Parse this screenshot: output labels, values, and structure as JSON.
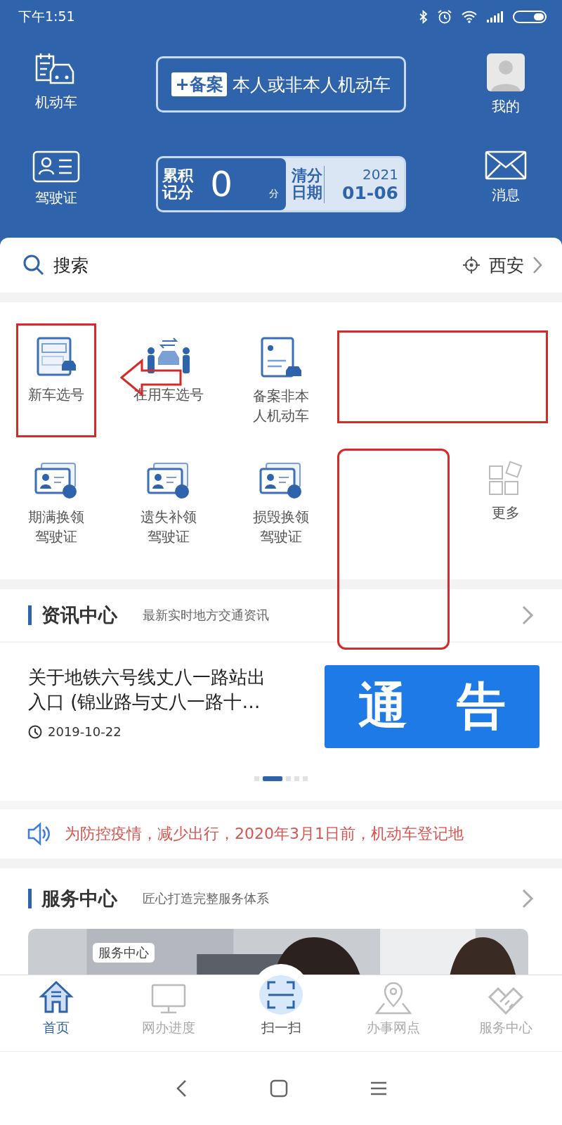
{
  "status_bar": {
    "time": "下午1:51"
  },
  "header": {
    "left": [
      {
        "label": "机动车"
      },
      {
        "label": "驾驶证"
      }
    ],
    "right": [
      {
        "label": "我的"
      },
      {
        "label": "消息"
      }
    ],
    "register_card": {
      "badge": "+备案",
      "text": "本人或非本人机动车"
    },
    "points_card": {
      "points_label": "累积记分",
      "points": "0",
      "unit": "分",
      "clear_label": "清分日期",
      "year": "2021",
      "date": "01-06"
    }
  },
  "search": {
    "placeholder": "搜索",
    "city": "西安"
  },
  "services": [
    [
      {
        "kind": "service",
        "label": "新车选号",
        "highlighted": true
      },
      {
        "kind": "service",
        "label": "在用车选号",
        "highlighted": false
      },
      {
        "kind": "service",
        "label": "备案非本人机动车",
        "highlighted": false
      },
      {
        "kind": "redacted"
      }
    ],
    [
      {
        "kind": "service",
        "label": "期满换领驾驶证",
        "highlighted": false
      },
      {
        "kind": "service",
        "label": "遗失补领驾驶证",
        "highlighted": false
      },
      {
        "kind": "service",
        "label": "损毁换领驾驶证",
        "highlighted": false
      },
      {
        "kind": "redacted"
      },
      {
        "kind": "more",
        "label": "更多",
        "highlighted": false
      }
    ]
  ],
  "news": {
    "title": "资讯中心",
    "subtitle": "最新实时地方交通资讯",
    "item": {
      "title": "关于地铁六号线丈八一路站出入口 (锦业路与丈八一路十…",
      "date": "2019-10-22",
      "banner": "通　告"
    },
    "pages": [
      {
        "selected": false
      },
      {
        "selected": true
      },
      {
        "selected": false
      },
      {
        "selected": false
      },
      {
        "selected": false
      }
    ]
  },
  "notice": {
    "text": "为防控疫情，减少出行，2020年3月1日前，机动车登记地"
  },
  "service_center": {
    "title": "服务中心",
    "subtitle": "匠心打造完整服务体系",
    "banner_label": "服务中心"
  },
  "tabs": [
    {
      "kind": "home",
      "label": "首页",
      "selected": true
    },
    {
      "kind": "progress",
      "label": "网办进度",
      "selected": false
    },
    {
      "kind": "scan",
      "label": "扫一扫",
      "selected": false
    },
    {
      "kind": "place",
      "label": "办事网点",
      "selected": false
    },
    {
      "kind": "service",
      "label": "服务中心",
      "selected": false
    }
  ]
}
